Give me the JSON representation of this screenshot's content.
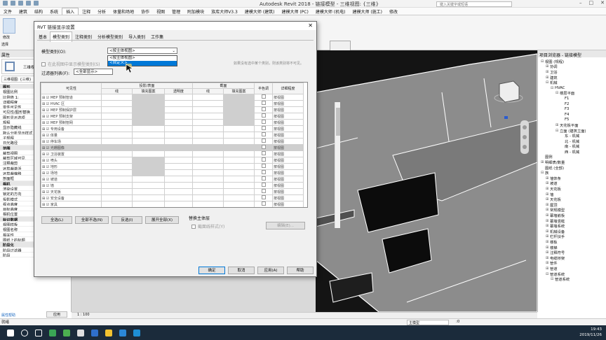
{
  "app": {
    "title": "Autodesk Revit 2018 - 链接模型 - 三维视图: {三维}",
    "search_placeholder": "键入关键字或短语"
  },
  "menu": [
    "文件",
    "建筑",
    "结构",
    "系统",
    "插入",
    "注释",
    "分析",
    "体量和场地",
    "协作",
    "视图",
    "管理",
    "附加模块",
    "族库大师V3.3",
    "建模大师 (建筑)",
    "建模大师 (PC)",
    "建模大师 (机电)",
    "建模大师 (施工)",
    "修改"
  ],
  "ribbon": {
    "btn": "修改",
    "group": "选择"
  },
  "properties": {
    "header": "属性",
    "type": "三维视图",
    "type_full": "三维视图: {三维}",
    "filter": "三维视图: {三维}",
    "edit_type": "编辑类型",
    "rows": [
      {
        "k": "图形",
        "v": "",
        "sec": true
      },
      {
        "k": "视图比例",
        "v": "1 : 100"
      },
      {
        "k": "比例值 1:",
        "v": "100"
      },
      {
        "k": "详细程度",
        "v": "中等"
      },
      {
        "k": "零件可见性",
        "v": "显示原状态"
      },
      {
        "k": "可见性/图形替换",
        "v": "编辑..."
      },
      {
        "k": "图形显示选项",
        "v": "编辑..."
      },
      {
        "k": "规程",
        "v": "协调"
      },
      {
        "k": "显示隐藏线",
        "v": "按规程"
      },
      {
        "k": "默认分析显示样式",
        "v": "无"
      },
      {
        "k": "子规程",
        "v": ""
      },
      {
        "k": "日光路径",
        "v": ""
      },
      {
        "k": "范围",
        "v": "",
        "sec": true
      },
      {
        "k": "裁剪视图",
        "v": ""
      },
      {
        "k": "裁剪区域可见",
        "v": ""
      },
      {
        "k": "注释裁剪",
        "v": ""
      },
      {
        "k": "远剪裁激活",
        "v": ""
      },
      {
        "k": "远剪裁偏移",
        "v": "304800.0"
      },
      {
        "k": "剖面框",
        "v": ""
      },
      {
        "k": "相机",
        "v": "",
        "sec": true
      },
      {
        "k": "渲染设置",
        "v": "编辑..."
      },
      {
        "k": "锁定的方向",
        "v": ""
      },
      {
        "k": "投影模式",
        "v": "正交"
      },
      {
        "k": "视点高度",
        "v": ""
      },
      {
        "k": "目标高度",
        "v": ""
      },
      {
        "k": "相机位置",
        "v": "调整"
      },
      {
        "k": "标识数据",
        "v": "",
        "sec": true
      },
      {
        "k": "视图样板",
        "v": "<无>"
      },
      {
        "k": "视图名称",
        "v": "{三维}"
      },
      {
        "k": "相关性",
        "v": "不相关"
      },
      {
        "k": "图纸上的标题",
        "v": ""
      },
      {
        "k": "阶段化",
        "v": "",
        "sec": true
      },
      {
        "k": "阶段过滤器",
        "v": "全部显示"
      },
      {
        "k": "阶段",
        "v": "新构造"
      }
    ],
    "help": "属性帮助",
    "apply": "应用"
  },
  "browser": {
    "header": "项目浏览器 - 链接模型",
    "items": [
      {
        "t": "视图 (规程)",
        "lv": 0,
        "tg": "⊟"
      },
      {
        "t": "协调",
        "lv": 1,
        "tg": "⊞"
      },
      {
        "t": "卫浴",
        "lv": 1,
        "tg": "⊞"
      },
      {
        "t": "建筑",
        "lv": 1,
        "tg": "⊞"
      },
      {
        "t": "机械",
        "lv": 1,
        "tg": "⊟"
      },
      {
        "t": "HVAC",
        "lv": 2,
        "tg": "⊟"
      },
      {
        "t": "楼层平面",
        "lv": 3,
        "tg": "⊟"
      },
      {
        "t": "F1",
        "lv": 4,
        "tg": ""
      },
      {
        "t": "F2",
        "lv": 4,
        "tg": ""
      },
      {
        "t": "F3",
        "lv": 4,
        "tg": ""
      },
      {
        "t": "F4",
        "lv": 4,
        "tg": ""
      },
      {
        "t": "F5",
        "lv": 4,
        "tg": ""
      },
      {
        "t": "天花板平面",
        "lv": 3,
        "tg": "⊞"
      },
      {
        "t": "立面 (建筑立面)",
        "lv": 3,
        "tg": "⊟"
      },
      {
        "t": "东 - 机械",
        "lv": 4,
        "tg": ""
      },
      {
        "t": "北 - 机械",
        "lv": 4,
        "tg": ""
      },
      {
        "t": "南 - 机械",
        "lv": 4,
        "tg": ""
      },
      {
        "t": "西 - 机械",
        "lv": 4,
        "tg": ""
      },
      {
        "t": "图例",
        "lv": 0,
        "tg": ""
      },
      {
        "t": "明细表/数量",
        "lv": 0,
        "tg": "⊞"
      },
      {
        "t": "图纸 (全部)",
        "lv": 0,
        "tg": ""
      },
      {
        "t": "族",
        "lv": 0,
        "tg": "⊟"
      },
      {
        "t": "墙饰条",
        "lv": 1,
        "tg": "⊞"
      },
      {
        "t": "坡道",
        "lv": 1,
        "tg": "⊞"
      },
      {
        "t": "天花板",
        "lv": 1,
        "tg": "⊞"
      },
      {
        "t": "墙",
        "lv": 1,
        "tg": "⊞"
      },
      {
        "t": "天花板",
        "lv": 1,
        "tg": "⊞"
      },
      {
        "t": "屋顶",
        "lv": 1,
        "tg": "⊞"
      },
      {
        "t": "常规模型",
        "lv": 1,
        "tg": "⊞"
      },
      {
        "t": "幕墙嵌板",
        "lv": 1,
        "tg": "⊞"
      },
      {
        "t": "幕墙竖梃",
        "lv": 1,
        "tg": "⊞"
      },
      {
        "t": "幕墙系统",
        "lv": 1,
        "tg": "⊞"
      },
      {
        "t": "机械设备",
        "lv": 1,
        "tg": "⊞"
      },
      {
        "t": "栏杆扶手",
        "lv": 1,
        "tg": "⊞"
      },
      {
        "t": "楼板",
        "lv": 1,
        "tg": "⊞"
      },
      {
        "t": "楼梯",
        "lv": 1,
        "tg": "⊞"
      },
      {
        "t": "注释符号",
        "lv": 1,
        "tg": "⊞"
      },
      {
        "t": "电缆桥架",
        "lv": 1,
        "tg": "⊞"
      },
      {
        "t": "管件",
        "lv": 1,
        "tg": "⊞"
      },
      {
        "t": "管道",
        "lv": 1,
        "tg": "⊞"
      },
      {
        "t": "管道系统",
        "lv": 1,
        "tg": "⊟"
      },
      {
        "t": "管道系统",
        "lv": 2,
        "tg": "⊟"
      }
    ]
  },
  "dialog": {
    "title": "RVT 链接显示设置",
    "tabs": [
      "基本",
      "模型类别",
      "注释类别",
      "分析模型类别",
      "导入类别",
      "工作集"
    ],
    "model_cat_label": "模型类别(O):",
    "model_cat_value": "<按主体视图>",
    "dropdown_options": [
      "<按主体视图>",
      "<自定义>"
    ],
    "show_in_host_label": "在此视图中显示模型类别(S)",
    "hint": "如果没有选中某个类别，则该类别将不可见。",
    "filter_label": "过滤器列表(F):",
    "filter_value": "<全部显示>",
    "grid": {
      "h_visibility": "可见性",
      "h_proj": "投影/表面",
      "h_cut": "截面",
      "h_half": "半色调",
      "h_detail": "详细程度",
      "sub": [
        "线",
        "填充图案",
        "透明度",
        "线",
        "填充图案"
      ],
      "rows": [
        "MEP 预制管道",
        "HVAC 区",
        "MEP 预制保护层",
        "MEP 预制支架",
        "MEP 预制管网",
        "专用设备",
        "体量",
        "停车场",
        "光栅图像",
        "卫浴装置",
        "喷头",
        "地形",
        "场地",
        "坡道",
        "墙",
        "天花板",
        "安全设备",
        "家具"
      ],
      "default": "按视图"
    },
    "buttons": {
      "all": "全选(L)",
      "none": "全部不选(N)",
      "invert": "反选(I)",
      "expand": "展开全部(X)"
    },
    "override_host_label": "替换主体层",
    "cut_line_label": "截面线样式(Y)",
    "edit_btn": "编辑(E)...",
    "ok": "确定",
    "cancel": "取消",
    "apply": "应用(A)",
    "help": "帮助"
  },
  "bgdialog": {
    "help": "帮助"
  },
  "viewctl": {
    "scale": "1 : 100"
  },
  "status": {
    "text": "就绪",
    "model": "主模型",
    "coord": ":0"
  },
  "taskbar": {
    "time": "19:43",
    "date": "2019/11/26"
  }
}
